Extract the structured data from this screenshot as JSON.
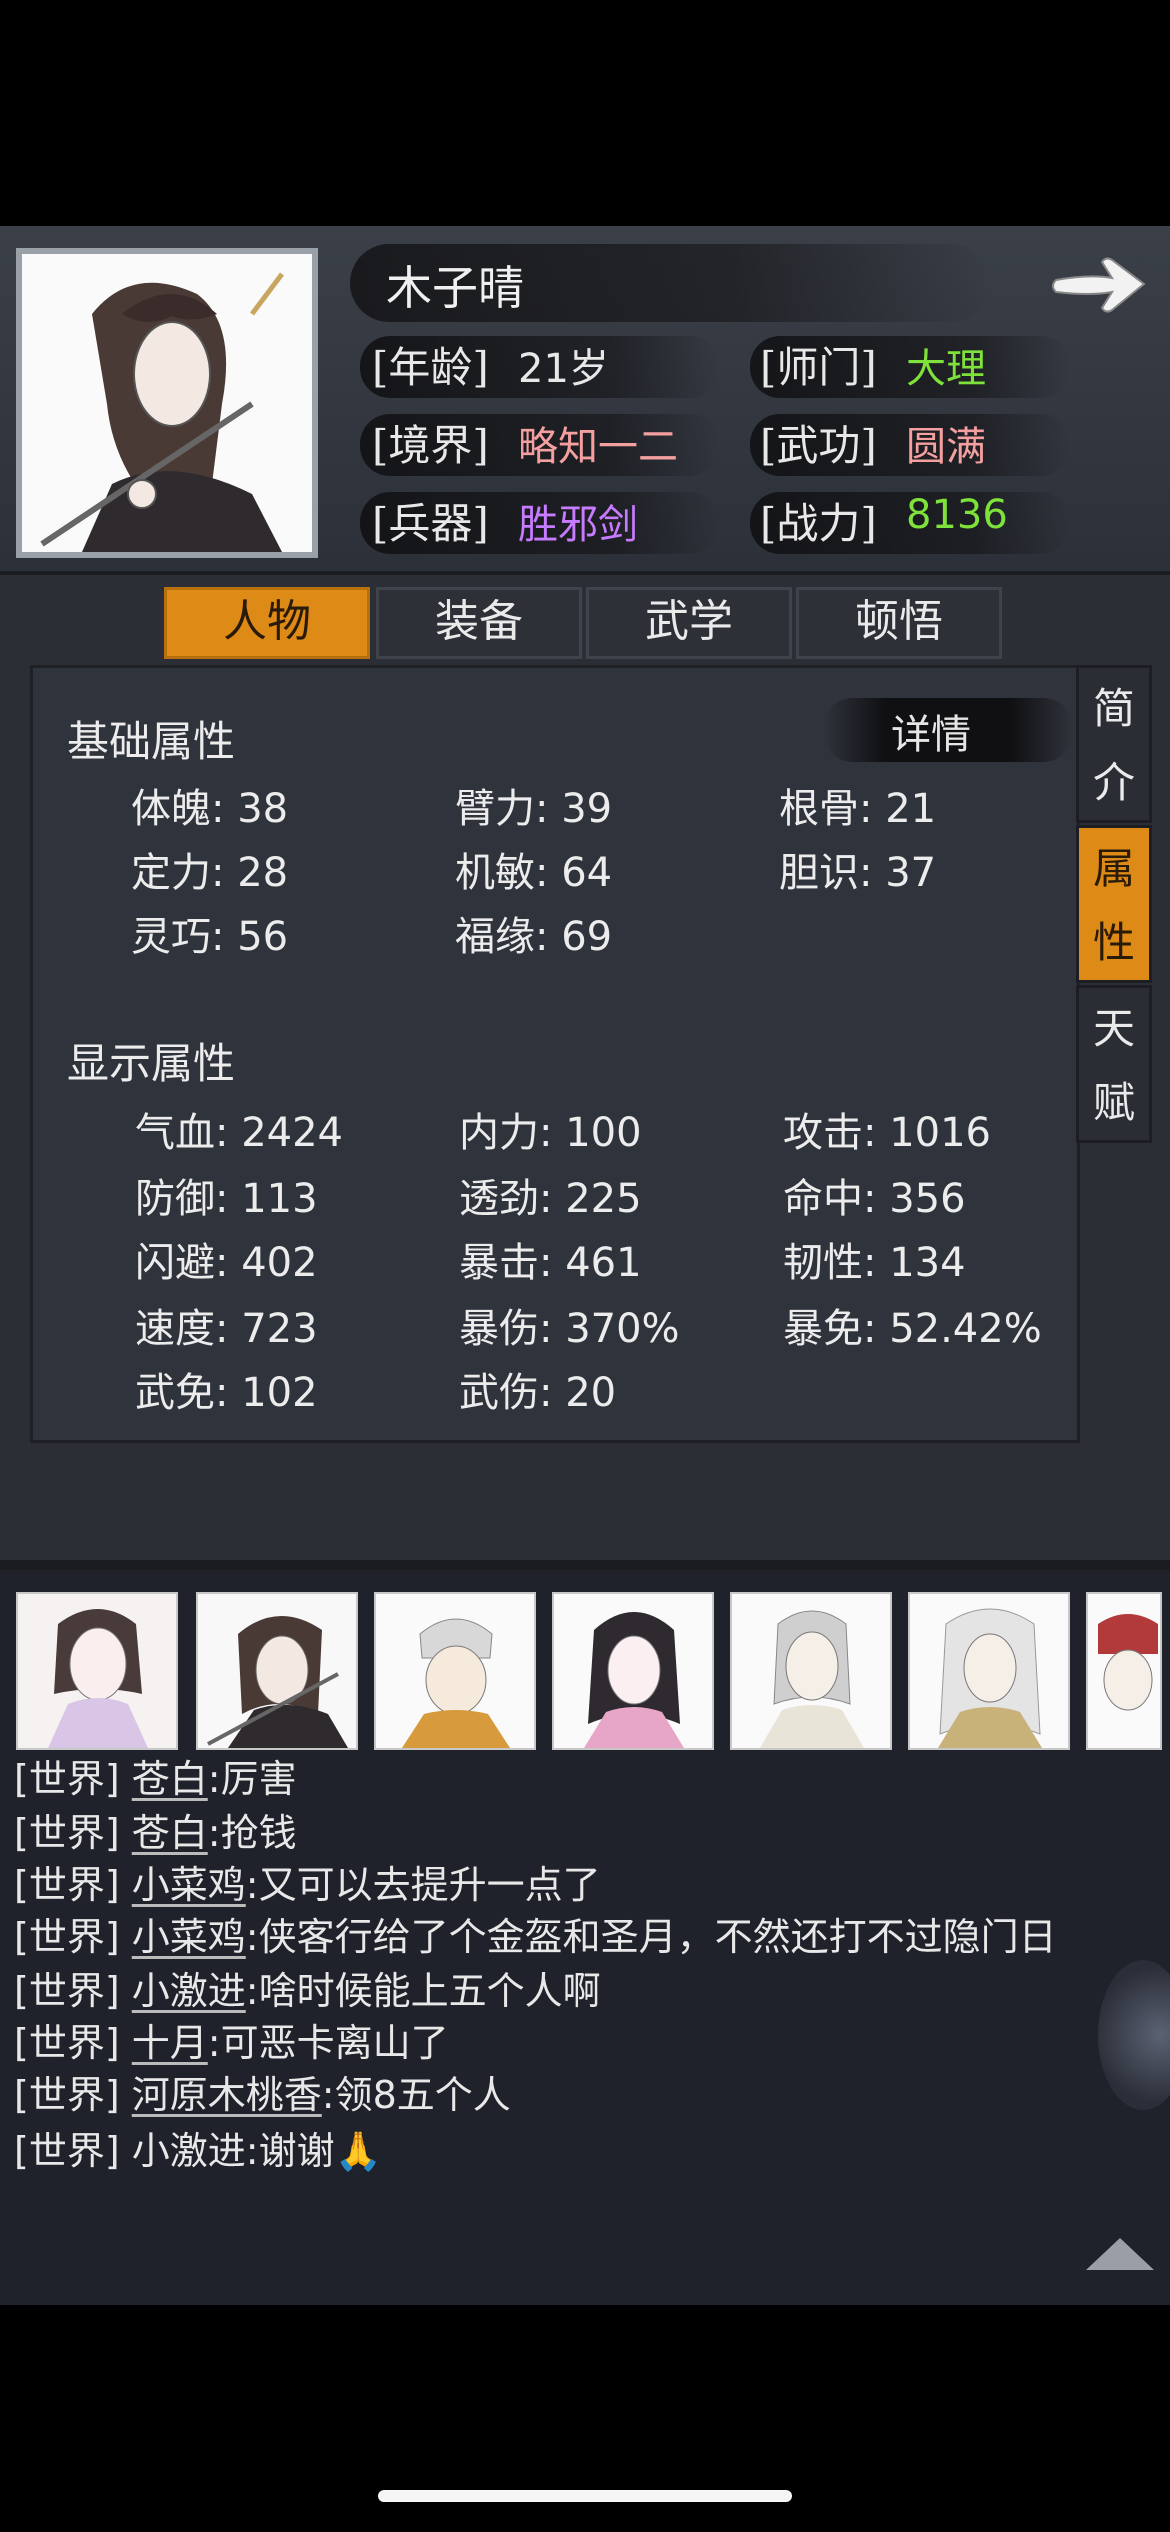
{
  "character": {
    "name": "木子晴",
    "fields": [
      {
        "label": "[年龄]",
        "value": "21岁",
        "color": "#e8e8e8"
      },
      {
        "label": "[师门]",
        "value": "大理",
        "color": "#7ee23a"
      },
      {
        "label": "[境界]",
        "value": "略知一二",
        "color": "#f4a0a0"
      },
      {
        "label": "[武功]",
        "value": "圆满",
        "color": "#f4a0a0"
      },
      {
        "label": "[兵器]",
        "value": "胜邪剑",
        "color": "#c77bff"
      },
      {
        "label": "[战力]",
        "value": "8136",
        "color": "#7ee23a"
      }
    ]
  },
  "tabs": [
    "人物",
    "装备",
    "武学",
    "顿悟"
  ],
  "active_tab": "人物",
  "side_tabs": [
    {
      "label_top": "简",
      "label_bottom": "介"
    },
    {
      "label_top": "属",
      "label_bottom": "性"
    },
    {
      "label_top": "天",
      "label_bottom": "赋"
    }
  ],
  "detail_label": "详情",
  "basic_section": {
    "title": "基础属性",
    "stats": [
      "体魄: 38",
      "臂力: 39",
      "根骨: 21",
      "定力: 28",
      "机敏: 64",
      "胆识: 37",
      "灵巧: 56",
      "福缘: 69"
    ]
  },
  "display_section": {
    "title": "显示属性",
    "stats": [
      "气血: 2424",
      "内力: 100",
      "攻击: 1016",
      "防御: 113",
      "透劲: 225",
      "命中: 356",
      "闪避: 402",
      "暴击: 461",
      "韧性: 134",
      "速度: 723",
      "暴伤: 370%",
      "暴免: 52.42%",
      "武免: 102",
      "武伤: 20"
    ]
  },
  "chat": [
    {
      "channel": "[世界]",
      "user": "苍白",
      "message": ":厉害"
    },
    {
      "channel": "[世界]",
      "user": "苍白",
      "message": ":抢钱"
    },
    {
      "channel": "[世界]",
      "user": "小菜鸡",
      "message": ":又可以去提升一点了"
    },
    {
      "channel": "[世界]",
      "user": "小菜鸡",
      "message": ":侠客行给了个金盔和圣月，不然还打不过隐门日"
    },
    {
      "channel": "[世界]",
      "user": "小激进",
      "message": ":啥时候能上五个人啊"
    },
    {
      "channel": "[世界]",
      "user": "十月",
      "message": ":可恶卡离山了"
    },
    {
      "channel": "[世界]",
      "user": "河原木桃香",
      "message": ":领8五个人"
    },
    {
      "channel": "[世界]",
      "user": "小激进",
      "message": ":谢谢🙏"
    }
  ]
}
